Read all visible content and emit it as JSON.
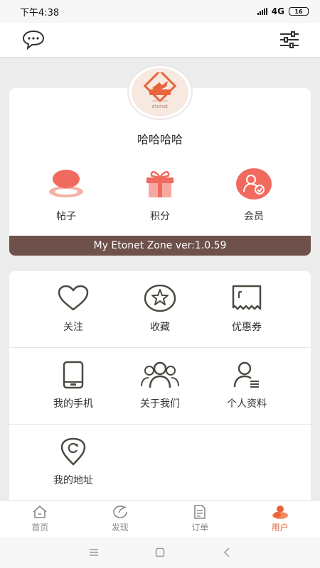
{
  "status_bar": {
    "time": "下午4:38",
    "network": "4G",
    "battery": "16"
  },
  "header": {
    "left_icon": "chat-bubble-icon",
    "right_icon": "filter-sliders-icon"
  },
  "profile": {
    "username": "哈哈哈哈",
    "avatar_logo_text": "etonet",
    "stats": [
      {
        "label": "帖子",
        "icon": "posts-icon"
      },
      {
        "label": "积分",
        "icon": "gift-icon"
      },
      {
        "label": "会员",
        "icon": "member-icon"
      }
    ],
    "version": "My Etonet Zone ver:1.0.59"
  },
  "menu": {
    "rows": [
      [
        {
          "label": "关注",
          "icon": "heart-icon"
        },
        {
          "label": "收藏",
          "icon": "star-icon"
        },
        {
          "label": "优惠券",
          "icon": "coupon-icon"
        }
      ],
      [
        {
          "label": "我的手机",
          "icon": "phone-icon"
        },
        {
          "label": "关于我们",
          "icon": "group-icon"
        },
        {
          "label": "个人资料",
          "icon": "profile-icon"
        }
      ],
      [
        {
          "label": "我的地址",
          "icon": "location-icon"
        }
      ]
    ]
  },
  "tabs": [
    {
      "label": "首页",
      "icon": "home-icon",
      "active": false
    },
    {
      "label": "发现",
      "icon": "discover-icon",
      "active": false
    },
    {
      "label": "订单",
      "icon": "order-icon",
      "active": false
    },
    {
      "label": "用户",
      "icon": "user-icon",
      "active": true
    }
  ],
  "colors": {
    "accent": "#e8643a",
    "version_bar": "#6e514b",
    "background": "#ececec",
    "icon_stroke": "#4a4a42",
    "stat_icon": "#f06a5e"
  }
}
